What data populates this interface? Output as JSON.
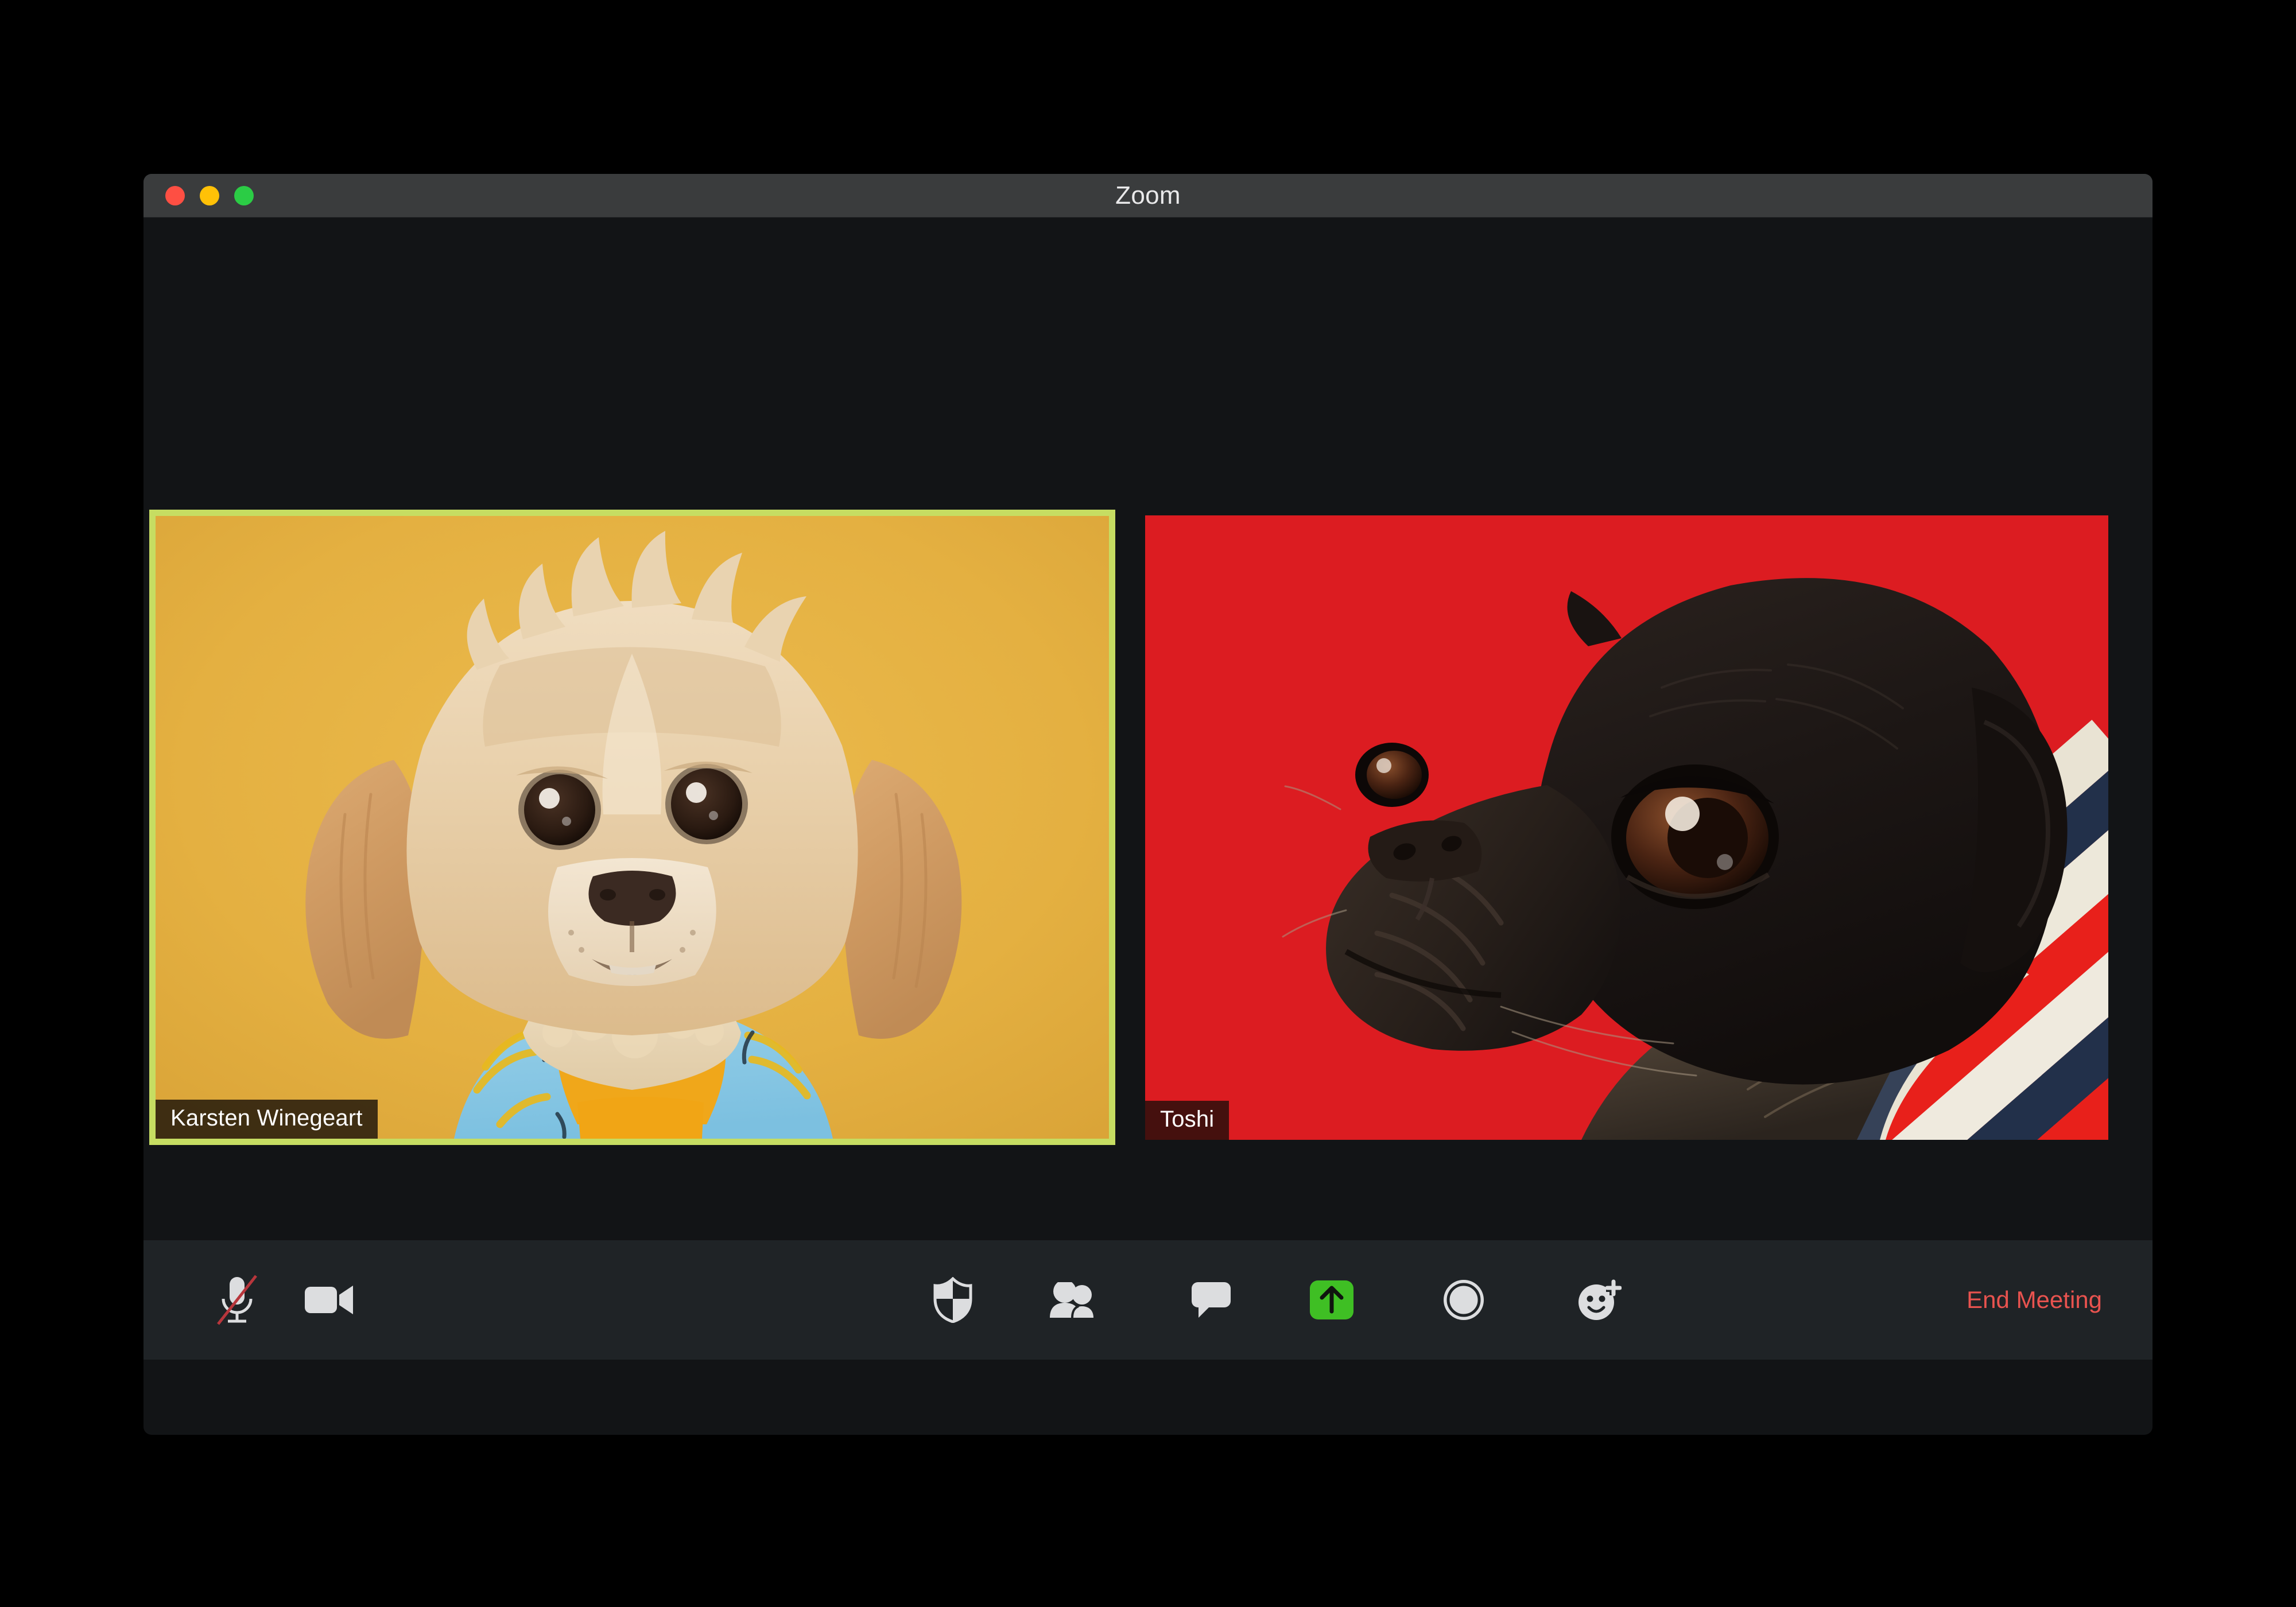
{
  "window": {
    "title": "Zoom",
    "traffic_lights": [
      {
        "name": "close",
        "color": "#fe4f43"
      },
      {
        "name": "minimize",
        "color": "#ffc107"
      },
      {
        "name": "maximize",
        "color": "#2bcc45"
      }
    ]
  },
  "stage": {
    "participants": [
      {
        "name": "Karsten Winegeart",
        "active_speaker": true,
        "active_border_color": "#c6dd62",
        "background_color": "#e3b142",
        "subject": "cream-fluffy-dog-in-blue-banana-shirt"
      },
      {
        "name": "Toshi",
        "active_speaker": false,
        "background_color": "#dc1c21",
        "subject": "black-pug-in-striped-sweater"
      }
    ]
  },
  "toolbar": {
    "background_color": "#1f2326",
    "buttons": [
      {
        "id": "mute",
        "icon": "microphone-muted-icon",
        "label": "Mute",
        "state": "muted",
        "slash_color": "#b8363c"
      },
      {
        "id": "video",
        "icon": "video-camera-icon",
        "label": "Stop Video",
        "state": "on"
      },
      {
        "id": "security",
        "icon": "shield-icon",
        "label": "Security"
      },
      {
        "id": "participants",
        "icon": "participants-icon",
        "label": "Participants"
      },
      {
        "id": "chat",
        "icon": "chat-bubble-icon",
        "label": "Chat"
      },
      {
        "id": "share-screen",
        "icon": "share-screen-arrow-icon",
        "label": "Share Screen",
        "accent_color": "#3fbf24"
      },
      {
        "id": "record",
        "icon": "record-circle-icon",
        "label": "Record"
      },
      {
        "id": "reactions",
        "icon": "smiley-plus-icon",
        "label": "Reactions"
      }
    ],
    "end_meeting_label": "End Meeting",
    "end_meeting_color": "#e8534f"
  }
}
